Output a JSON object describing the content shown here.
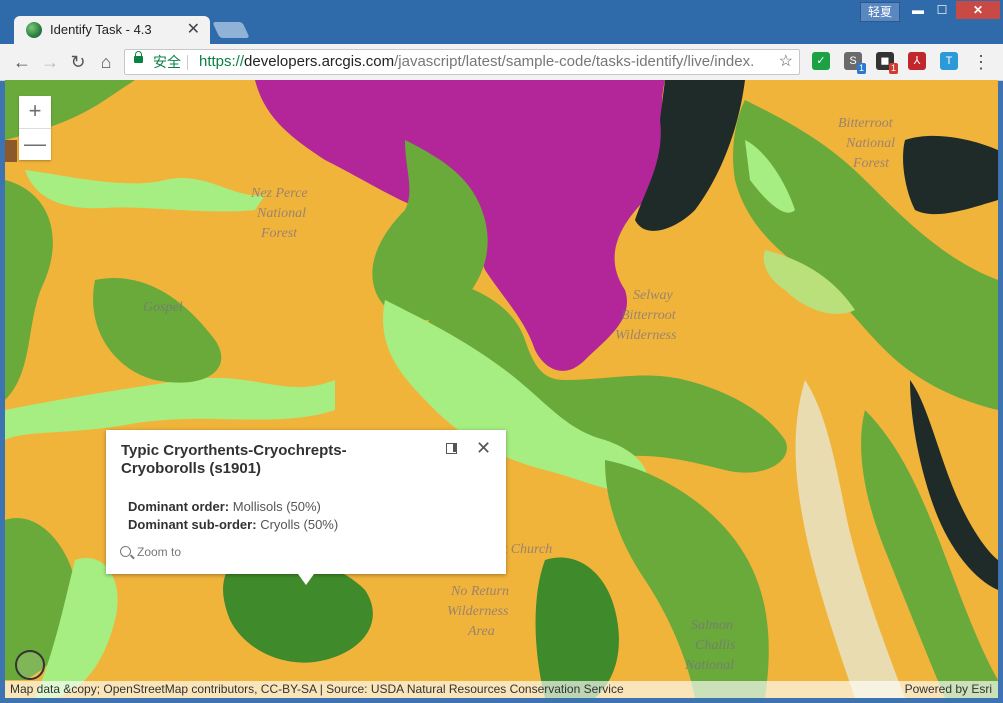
{
  "browser": {
    "tab_title": "Identify Task - 4.3",
    "tab_close": "✕",
    "window_user": "轻夏",
    "window_min": "▬",
    "window_max": "☐",
    "window_close": "✕",
    "secure_label": "安全",
    "url_scheme": "https://",
    "url_host": "developers.arcgis.com",
    "url_path": "/javascript/latest/sample-code/tasks-identify/live/index.",
    "nav": {
      "back": "←",
      "forward": "→",
      "reload": "↻",
      "home": "⌂"
    },
    "bookmark_star": "☆",
    "menu": "⋮",
    "extensions": [
      {
        "name": "shield-extension-icon",
        "text": "✓",
        "color": "#1ca245"
      },
      {
        "name": "s-extension-icon",
        "text": "S",
        "color": "#6a6a6a",
        "badge": "1"
      },
      {
        "name": "printer-extension-icon",
        "text": "◼",
        "color": "#333333",
        "badge": "1"
      },
      {
        "name": "pdf-extension-icon",
        "text": "⅄",
        "color": "#c0262c"
      },
      {
        "name": "translate-extension-icon",
        "text": "T",
        "color": "#2b9ad6"
      }
    ]
  },
  "map": {
    "zoom_in": "+",
    "zoom_out": "—",
    "popup": {
      "title": "Typic Cryorthents-Cryochrepts-Cryoborolls (s1901)",
      "close": "✕",
      "fields": [
        {
          "label": "Dominant order:",
          "value": "Mollisols (50%)"
        },
        {
          "label": "Dominant sub-order:",
          "value": "Cryolls (50%)"
        }
      ],
      "zoom_to": "Zoom to"
    },
    "attribution_left": "Map data &copy; OpenStreetMap contributors, CC-BY-SA | Source: USDA Natural Resources Conservation Service",
    "attribution_right": "Powered by Esri",
    "labels": [
      "Nez Perce",
      "National",
      "Forest",
      "Gospel",
      "Bitterroot",
      "National",
      "Forest",
      "Frank Church",
      "No Return",
      "Wilderness",
      "Area",
      "Salmon",
      "Challis",
      "National",
      "Selway",
      "Bitterroot",
      "Wilderness"
    ],
    "colors": {
      "orange": "#f1b43b",
      "green": "#6aaa3a",
      "dark_green": "#3f8a2a",
      "light_green": "#a6ee82",
      "magenta": "#b3269a",
      "dark": "#1e2b28",
      "tan": "#e9dcb0"
    }
  }
}
